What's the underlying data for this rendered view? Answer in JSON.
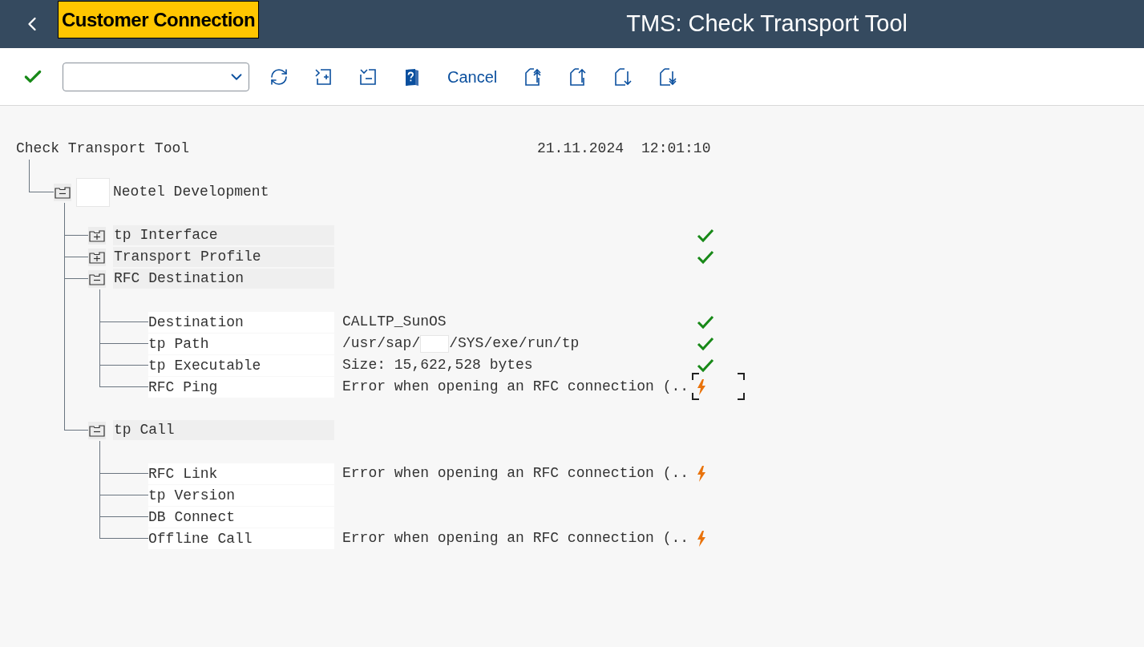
{
  "header": {
    "badge": "Customer Connection",
    "title": "TMS: Check Transport Tool"
  },
  "toolbar": [
    {
      "kind": "confirm"
    },
    {
      "kind": "dropdown"
    },
    {
      "kind": "refresh"
    },
    {
      "kind": "page-plus"
    },
    {
      "kind": "page-minus"
    },
    {
      "kind": "help"
    },
    {
      "kind": "text",
      "label": "Cancel"
    },
    {
      "kind": "page-up-double"
    },
    {
      "kind": "page-up"
    },
    {
      "kind": "page-down"
    },
    {
      "kind": "page-down-double"
    }
  ],
  "report": {
    "title": "Check Transport Tool",
    "date": "21.11.2024",
    "time": "12:01:10",
    "children": [
      {
        "label": "Neotel Development",
        "expanded": true,
        "children": [
          {
            "label": "tp Interface",
            "expanded": false,
            "passed": true
          },
          {
            "label": "Transport Profile",
            "expanded": false,
            "passed": true
          },
          {
            "label": "RFC Destination",
            "expanded": true,
            "children": [
              {
                "label": "Destination",
                "value": "CALLTP_SunOS",
                "passed": true,
                "focused": false
              },
              {
                "label": "tp Path",
                "value_parts": [
                  "/usr/sap/",
                  "/SYS/exe/run/tp"
                ],
                "passed": true,
                "focused": false
              },
              {
                "label": "tp Executable",
                "value": "Size: 15,622,528 bytes",
                "passed": true,
                "focused": false
              },
              {
                "label": "RFC Ping",
                "value": "Error when opening an RFC connection (..",
                "passed": false,
                "focused": true
              }
            ]
          },
          {
            "label": "tp Call",
            "expanded": true,
            "children": [
              {
                "label": "RFC Link",
                "value": "Error when opening an RFC connection (..",
                "passed": false,
                "focused": false
              },
              {
                "label": "tp Version",
                "focused": false
              },
              {
                "label": "DB Connect",
                "focused": false
              },
              {
                "label": "Offline Call",
                "value": "Error when opening an RFC connection (..",
                "passed": false,
                "focused": false
              }
            ]
          }
        ]
      }
    ]
  }
}
